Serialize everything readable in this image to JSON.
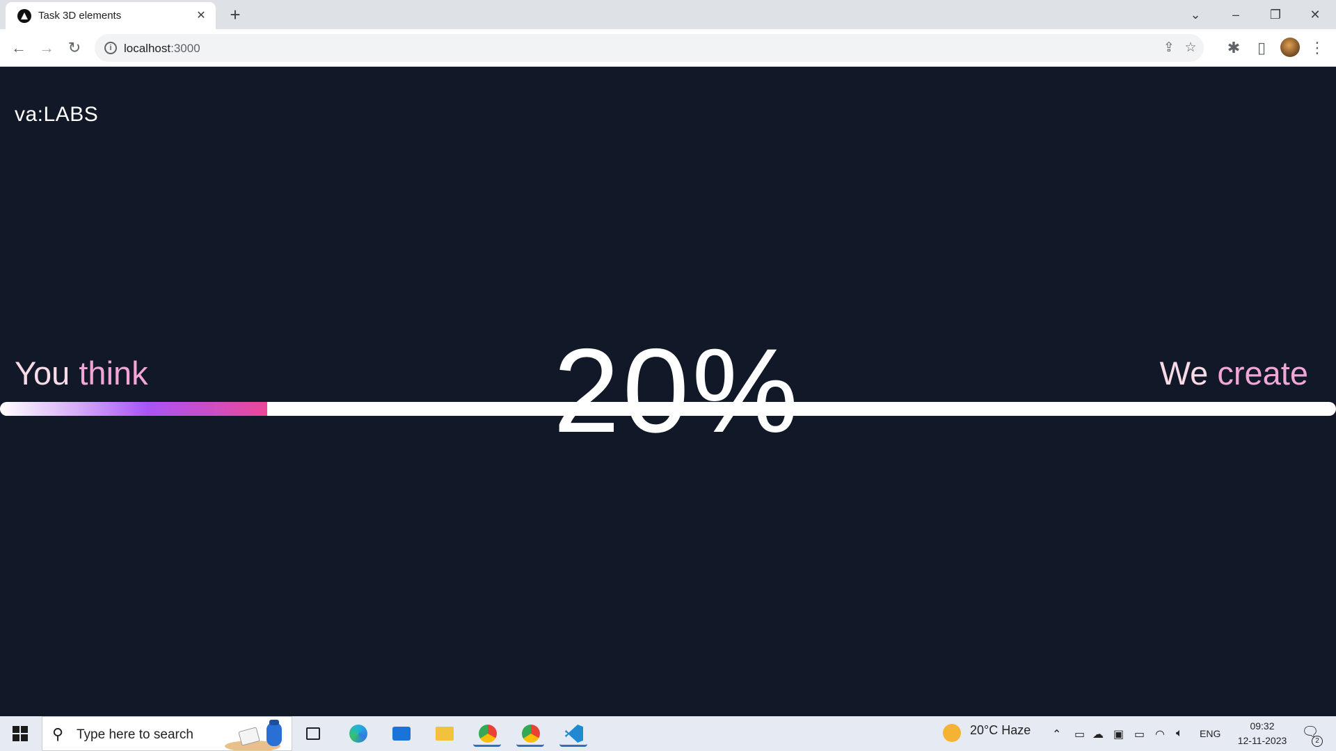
{
  "browser": {
    "tab_title": "Task 3D elements",
    "tab_close": "✕",
    "new_tab": "+",
    "url_host": "localhost",
    "url_port": ":3000",
    "window_controls": {
      "chevron": "⌄",
      "minimize": "–",
      "restore": "❐",
      "close": "✕"
    },
    "toolbar_icons": {
      "back": "←",
      "forward": "→",
      "reload": "↻",
      "share": "⇪",
      "star": "☆",
      "extensions": "✱",
      "sidepanel": "▯",
      "menu": "⋮"
    }
  },
  "page": {
    "brand_prefix": "va:",
    "brand_name": "LABS",
    "left_word1": "You",
    "left_word2": "think",
    "right_word1": "We",
    "right_word2": "create",
    "progress_percent_text": "20%",
    "progress_fraction": 0.2,
    "colors": {
      "background": "#111827",
      "track": "#ffffff",
      "gradient": [
        "#ffffff",
        "#d4a8f7",
        "#a855f7",
        "#ec4899"
      ],
      "word_light": "#f9dbe8",
      "word_pink": "#f0a7d8"
    }
  },
  "taskbar": {
    "search_placeholder": "Type here to search",
    "weather": "20°C  Haze",
    "language": "ENG",
    "time": "09:32",
    "date": "12-11-2023",
    "notification_count": "2",
    "apps": [
      "task-view",
      "edge",
      "mail",
      "file-explorer",
      "chrome",
      "chrome-profile",
      "vscode"
    ]
  }
}
